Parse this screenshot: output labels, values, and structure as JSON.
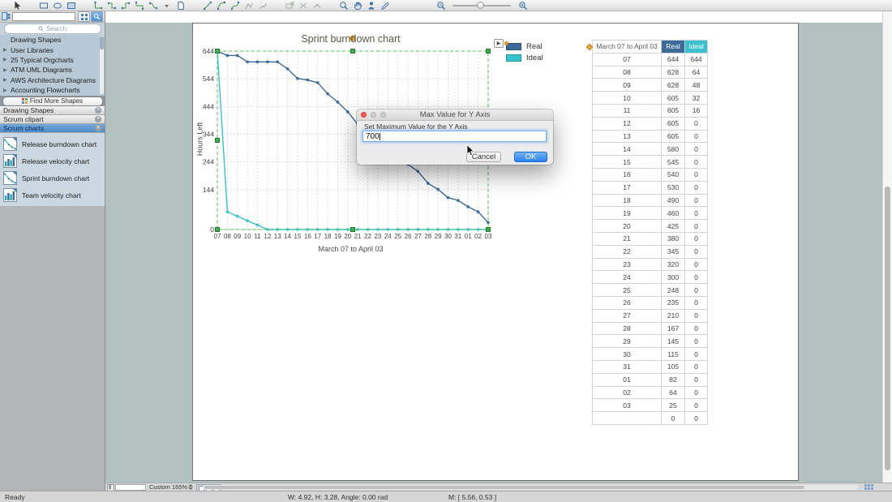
{
  "toolbar": {
    "groups": [
      [
        "select-tool"
      ],
      [
        "rectangle-tool",
        "ellipse-tool",
        "picture-tool"
      ],
      [
        "smart-connector-tool",
        "elbow-connector-tool",
        "elbow-connector-2-tool",
        "tree-connector-tool",
        "curved-connector-tool",
        "connector-options-caret",
        "page-tool"
      ],
      [
        "line-tool",
        "arc-tool",
        "bezier-tool",
        "polyline-tool",
        "freehand-tool"
      ],
      [
        "reshape-tool",
        "trim-tool",
        "join-tool"
      ],
      [
        "zoom-tool",
        "pan-tool",
        "format-painter-tool",
        "pencil-tool"
      ]
    ]
  },
  "sidebar": {
    "search_placeholder": "Search",
    "tree_items": [
      {
        "label": "Drawing Shapes",
        "expandable": false
      },
      {
        "label": "User Libraries",
        "expandable": true
      },
      {
        "label": "25 Typical Orgcharts",
        "expandable": true
      },
      {
        "label": "ATM UML Diagrams",
        "expandable": true
      },
      {
        "label": "AWS Architecture Diagrams",
        "expandable": true
      },
      {
        "label": "Accounting Flowcharts",
        "expandable": true
      }
    ],
    "find_more_label": "Find More Shapes",
    "sections": [
      {
        "label": "Drawing Shapes",
        "selected": false
      },
      {
        "label": "Scrum clipart",
        "selected": false
      },
      {
        "label": "Scrum charts",
        "selected": true
      }
    ],
    "library_items": [
      {
        "label": "Release burndown chart",
        "icon": "line-chart"
      },
      {
        "label": "Release velocity chart",
        "icon": "bar-chart"
      },
      {
        "label": "Sprint burndown chart",
        "icon": "line-chart"
      },
      {
        "label": "Team velocity chart",
        "icon": "bar-chart"
      }
    ]
  },
  "chart_data": {
    "type": "line",
    "title": "Sprint burndown chart",
    "xlabel": "March 07 to April 03",
    "ylabel": "Hours Left",
    "categories": [
      "07",
      "08",
      "09",
      "10",
      "11",
      "12",
      "13",
      "14",
      "15",
      "16",
      "17",
      "18",
      "19",
      "20",
      "21",
      "22",
      "23",
      "24",
      "25",
      "26",
      "27",
      "28",
      "29",
      "30",
      "31",
      "01",
      "02",
      "03"
    ],
    "series": [
      {
        "name": "Real",
        "color": "#3b6a9b",
        "values": [
          644,
          628,
          628,
          605,
          605,
          605,
          605,
          580,
          545,
          540,
          530,
          490,
          460,
          425,
          380,
          345,
          320,
          300,
          248,
          235,
          210,
          167,
          145,
          115,
          105,
          82,
          64,
          25
        ]
      },
      {
        "name": "Ideal",
        "color": "#35c3cd",
        "values": [
          644,
          64,
          48,
          32,
          16,
          0,
          0,
          0,
          0,
          0,
          0,
          0,
          0,
          0,
          0,
          0,
          0,
          0,
          0,
          0,
          0,
          0,
          0,
          0,
          0,
          0,
          0,
          0
        ]
      }
    ],
    "y_ticks": [
      644,
      544,
      444,
      344,
      244,
      144,
      0
    ],
    "ylim": [
      0,
      644
    ],
    "grid": true,
    "legend_position": "right"
  },
  "table": {
    "header": {
      "date": "March 07 to April 03",
      "real": "Real",
      "ideal": "Ideal"
    },
    "rows": [
      [
        "07",
        644,
        644
      ],
      [
        "08",
        628,
        64
      ],
      [
        "09",
        628,
        48
      ],
      [
        "10",
        605,
        32
      ],
      [
        "11",
        605,
        16
      ],
      [
        "12",
        605,
        0
      ],
      [
        "13",
        605,
        0
      ],
      [
        "14",
        580,
        0
      ],
      [
        "15",
        545,
        0
      ],
      [
        "16",
        540,
        0
      ],
      [
        "17",
        530,
        0
      ],
      [
        "18",
        490,
        0
      ],
      [
        "19",
        460,
        0
      ],
      [
        "20",
        425,
        0
      ],
      [
        "21",
        380,
        0
      ],
      [
        "22",
        345,
        0
      ],
      [
        "23",
        320,
        0
      ],
      [
        "24",
        300,
        0
      ],
      [
        "25",
        248,
        0
      ],
      [
        "26",
        235,
        0
      ],
      [
        "27",
        210,
        0
      ],
      [
        "28",
        167,
        0
      ],
      [
        "29",
        145,
        0
      ],
      [
        "30",
        115,
        0
      ],
      [
        "31",
        105,
        0
      ],
      [
        "01",
        82,
        0
      ],
      [
        "02",
        64,
        0
      ],
      [
        "03",
        25,
        0
      ],
      [
        "",
        0,
        0
      ]
    ]
  },
  "dialog": {
    "title": "Max Value for Y Axis",
    "label": "Set Maximum Value for the Y Axis",
    "input_value": "700",
    "cancel_label": "Cancel",
    "ok_label": "OK"
  },
  "page_controls": {
    "zoom_label": "Custom 165%"
  },
  "status_bar": {
    "ready": "Ready",
    "dimensions": "W: 4.92,  H: 3.28,  Angle: 0.00 rad",
    "mouse": "M: [ 5.56, 0.53 ]"
  },
  "colors": {
    "real": "#3b6a9b",
    "ideal": "#35c3cd",
    "real_header": "#3d6a96",
    "ideal_header": "#3bc0cf",
    "selection": "#55c25c",
    "handle": "#43ae4b"
  }
}
